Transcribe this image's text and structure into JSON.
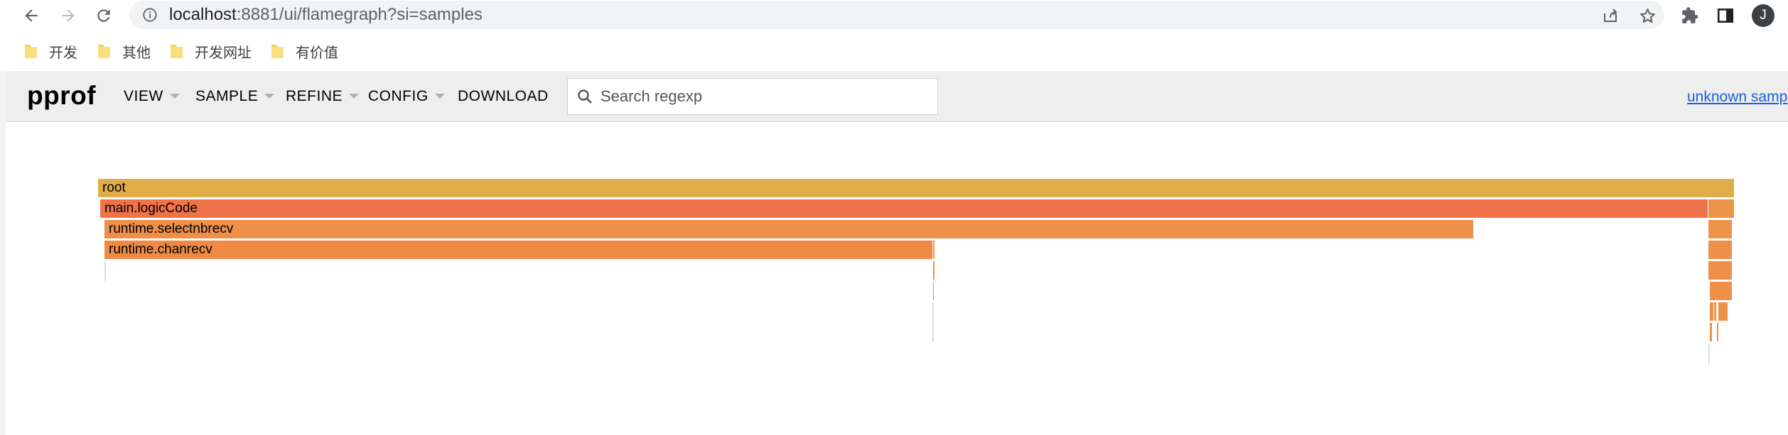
{
  "browser": {
    "url_host": "localhost",
    "url_rest": ":8881/ui/flamegraph?si=samples",
    "avatar_initial": "J",
    "bookmarks": [
      {
        "label": "开发"
      },
      {
        "label": "其他"
      },
      {
        "label": "开发网址"
      },
      {
        "label": "有价值"
      }
    ]
  },
  "app": {
    "title": "pprof",
    "menus": [
      "VIEW",
      "SAMPLE",
      "REFINE",
      "CONFIG",
      "DOWNLOAD"
    ],
    "search_placeholder": "Search regexp",
    "sample_link": "unknown samp"
  },
  "flamegraph": {
    "frames": [
      {
        "label": "root",
        "color": "#e0ad4a"
      },
      {
        "label": "main.logicCode",
        "color": "#f07248"
      },
      {
        "label": "",
        "color": "#ee944a"
      },
      {
        "label": "runtime.selectnbrecv",
        "color": "#ee8f4a"
      },
      {
        "label": "runtime.chanrecv",
        "color": "#ee8a44"
      },
      {
        "label": "",
        "color": "#ee944a"
      },
      {
        "label": "",
        "color": "#ee904a"
      },
      {
        "label": "",
        "color": "#ee904a"
      },
      {
        "label": "",
        "color": "#ee904a"
      },
      {
        "label": "",
        "color": "#ee904a"
      },
      {
        "label": "",
        "color": "#ee904a"
      },
      {
        "label": "",
        "color": "#ee904a"
      },
      {
        "label": "",
        "color": "#ee904a"
      },
      {
        "label": "",
        "color": "#ee904a"
      },
      {
        "label": "",
        "color": "#ee904a"
      },
      {
        "label": "",
        "color": "#ee904a"
      },
      {
        "label": "",
        "color": "#ee904a"
      }
    ]
  }
}
